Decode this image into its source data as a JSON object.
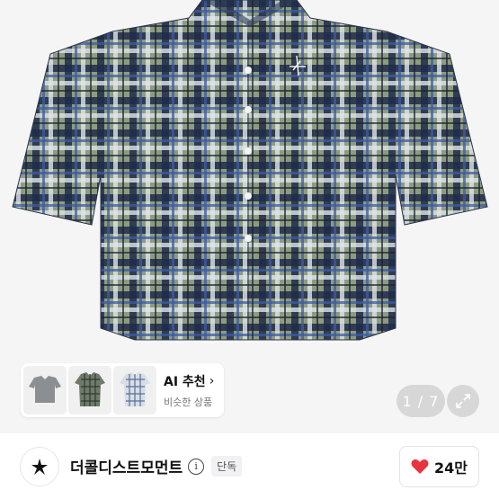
{
  "hero": {
    "image_alt": "plaid short-sleeve shirt",
    "counter": "1 / 7"
  },
  "ai_recommend": {
    "title": "AI 추천",
    "subtitle": "비슷한 상품"
  },
  "brand": {
    "name": "더콜디스트모먼트",
    "badge": "단독",
    "likes": "24만"
  },
  "colors": {
    "heart": "#e8343c",
    "plaid_navy": "#1f2c4a",
    "plaid_olive": "#8a9a78",
    "plaid_blue": "#3c5aa6"
  }
}
